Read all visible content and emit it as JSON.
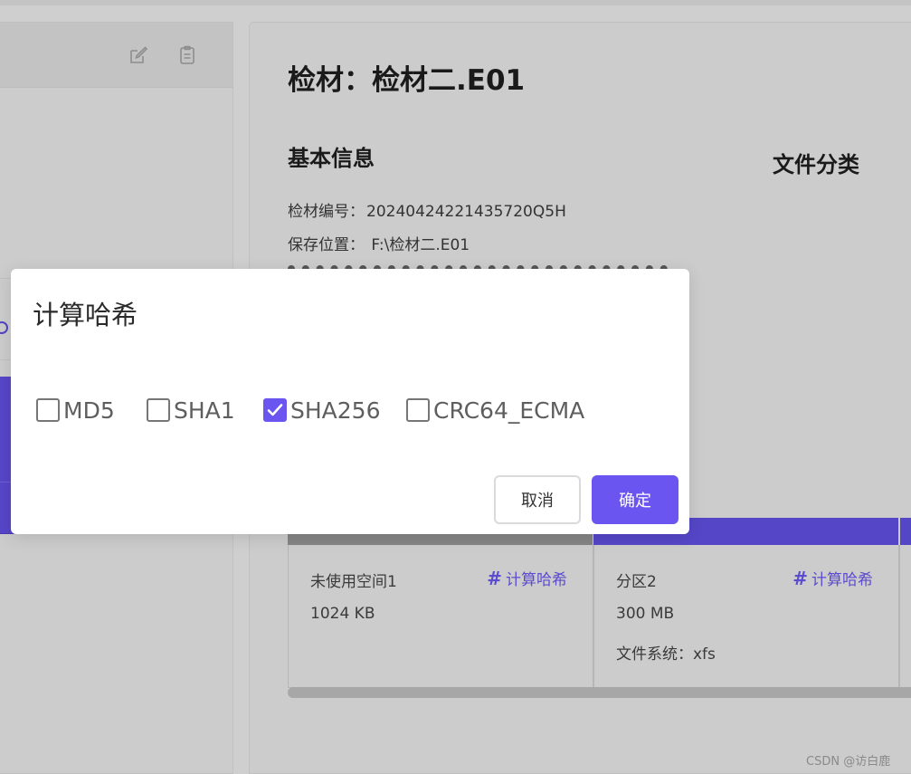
{
  "left_panel": {
    "toolbar_icons": [
      "edit-icon",
      "clipboard-icon"
    ]
  },
  "main": {
    "title": "检材：检材二.E01",
    "basic_info_title": "基本信息",
    "file_class_title": "文件分类",
    "info": [
      {
        "label": "检材编号：",
        "value": "20240424221435720Q5H"
      },
      {
        "label": "保存位置：",
        "value": " F:\\检材二.E01"
      }
    ],
    "partitions": [
      {
        "name": "未使用空间1",
        "size": "1024 KB",
        "fs": "",
        "hash_label": "计算哈希",
        "bar_color": "#858585"
      },
      {
        "name": "分区2",
        "size": "300 MB",
        "fs": "文件系统：xfs",
        "hash_label": "计算哈希",
        "bar_color": "#5546c8"
      }
    ],
    "hash_icon": "#"
  },
  "dialog": {
    "title": "计算哈希",
    "options": [
      {
        "label": "MD5",
        "checked": false
      },
      {
        "label": "SHA1",
        "checked": false
      },
      {
        "label": "SHA256",
        "checked": true
      },
      {
        "label": "CRC64_ECMA",
        "checked": false
      }
    ],
    "cancel_label": "取消",
    "ok_label": "确定"
  },
  "watermark": "CSDN @访白鹿",
  "colors": {
    "accent": "#6a55f1",
    "partition_purple": "#5546c8",
    "overlay_bg": "#cfcfcf"
  }
}
